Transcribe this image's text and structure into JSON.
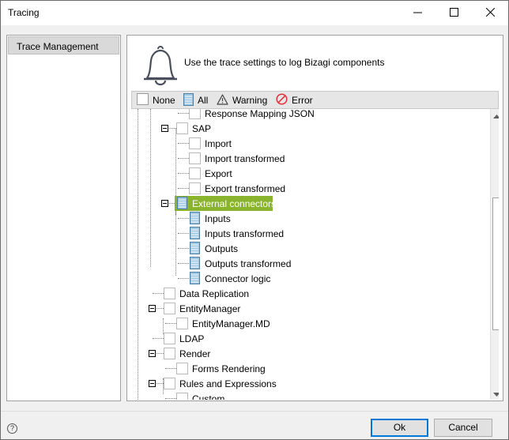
{
  "window": {
    "title": "Tracing",
    "controls": [
      "minimize-icon",
      "maximize-icon",
      "close-icon"
    ]
  },
  "nav": {
    "items": [
      {
        "label": "Trace Management",
        "selected": true
      }
    ]
  },
  "panel": {
    "description": "Use the trace settings to log Bizagi components",
    "icon": "bell-icon",
    "filters": [
      {
        "label": "None",
        "icon": "checkbox-empty-icon"
      },
      {
        "label": "All",
        "icon": "all-list-icon"
      },
      {
        "label": "Warning",
        "icon": "warning-triangle-icon"
      },
      {
        "label": "Error",
        "icon": "error-circle-icon"
      }
    ]
  },
  "tree": {
    "nodes": [
      {
        "label": "Response Mapping JSON",
        "level": 3,
        "state": "none"
      },
      {
        "label": "SAP",
        "level": 2,
        "state": "none",
        "expanded": true
      },
      {
        "label": "Import",
        "level": 3,
        "state": "none"
      },
      {
        "label": "Import transformed",
        "level": 3,
        "state": "none"
      },
      {
        "label": "Export",
        "level": 3,
        "state": "none"
      },
      {
        "label": "Export transformed",
        "level": 3,
        "state": "none"
      },
      {
        "label": "External connectors",
        "level": 2,
        "state": "all",
        "expanded": true,
        "selected": true
      },
      {
        "label": "Inputs",
        "level": 3,
        "state": "all"
      },
      {
        "label": "Inputs transformed",
        "level": 3,
        "state": "all"
      },
      {
        "label": "Outputs",
        "level": 3,
        "state": "all"
      },
      {
        "label": "Outputs transformed",
        "level": 3,
        "state": "all"
      },
      {
        "label": "Connector logic",
        "level": 3,
        "state": "all"
      },
      {
        "label": "Data Replication",
        "level": 1,
        "state": "none"
      },
      {
        "label": "EntityManager",
        "level": 1,
        "state": "none",
        "expanded": true
      },
      {
        "label": "EntityManager.MD",
        "level": 2,
        "state": "none"
      },
      {
        "label": "LDAP",
        "level": 1,
        "state": "none"
      },
      {
        "label": "Render",
        "level": 1,
        "state": "none",
        "expanded": true
      },
      {
        "label": "Forms Rendering",
        "level": 2,
        "state": "none"
      },
      {
        "label": "Rules and Expressions",
        "level": 1,
        "state": "none",
        "expanded": true
      },
      {
        "label": "Custom",
        "level": 2,
        "state": "none"
      }
    ]
  },
  "footer": {
    "help_icon": "help-circle-icon",
    "help_label": "?",
    "ok_label": "Ok",
    "cancel_label": "Cancel"
  },
  "colors": {
    "selection": "#8ab42e",
    "focus_border": "#0078d7",
    "all_icon": "#6fa5c9"
  }
}
